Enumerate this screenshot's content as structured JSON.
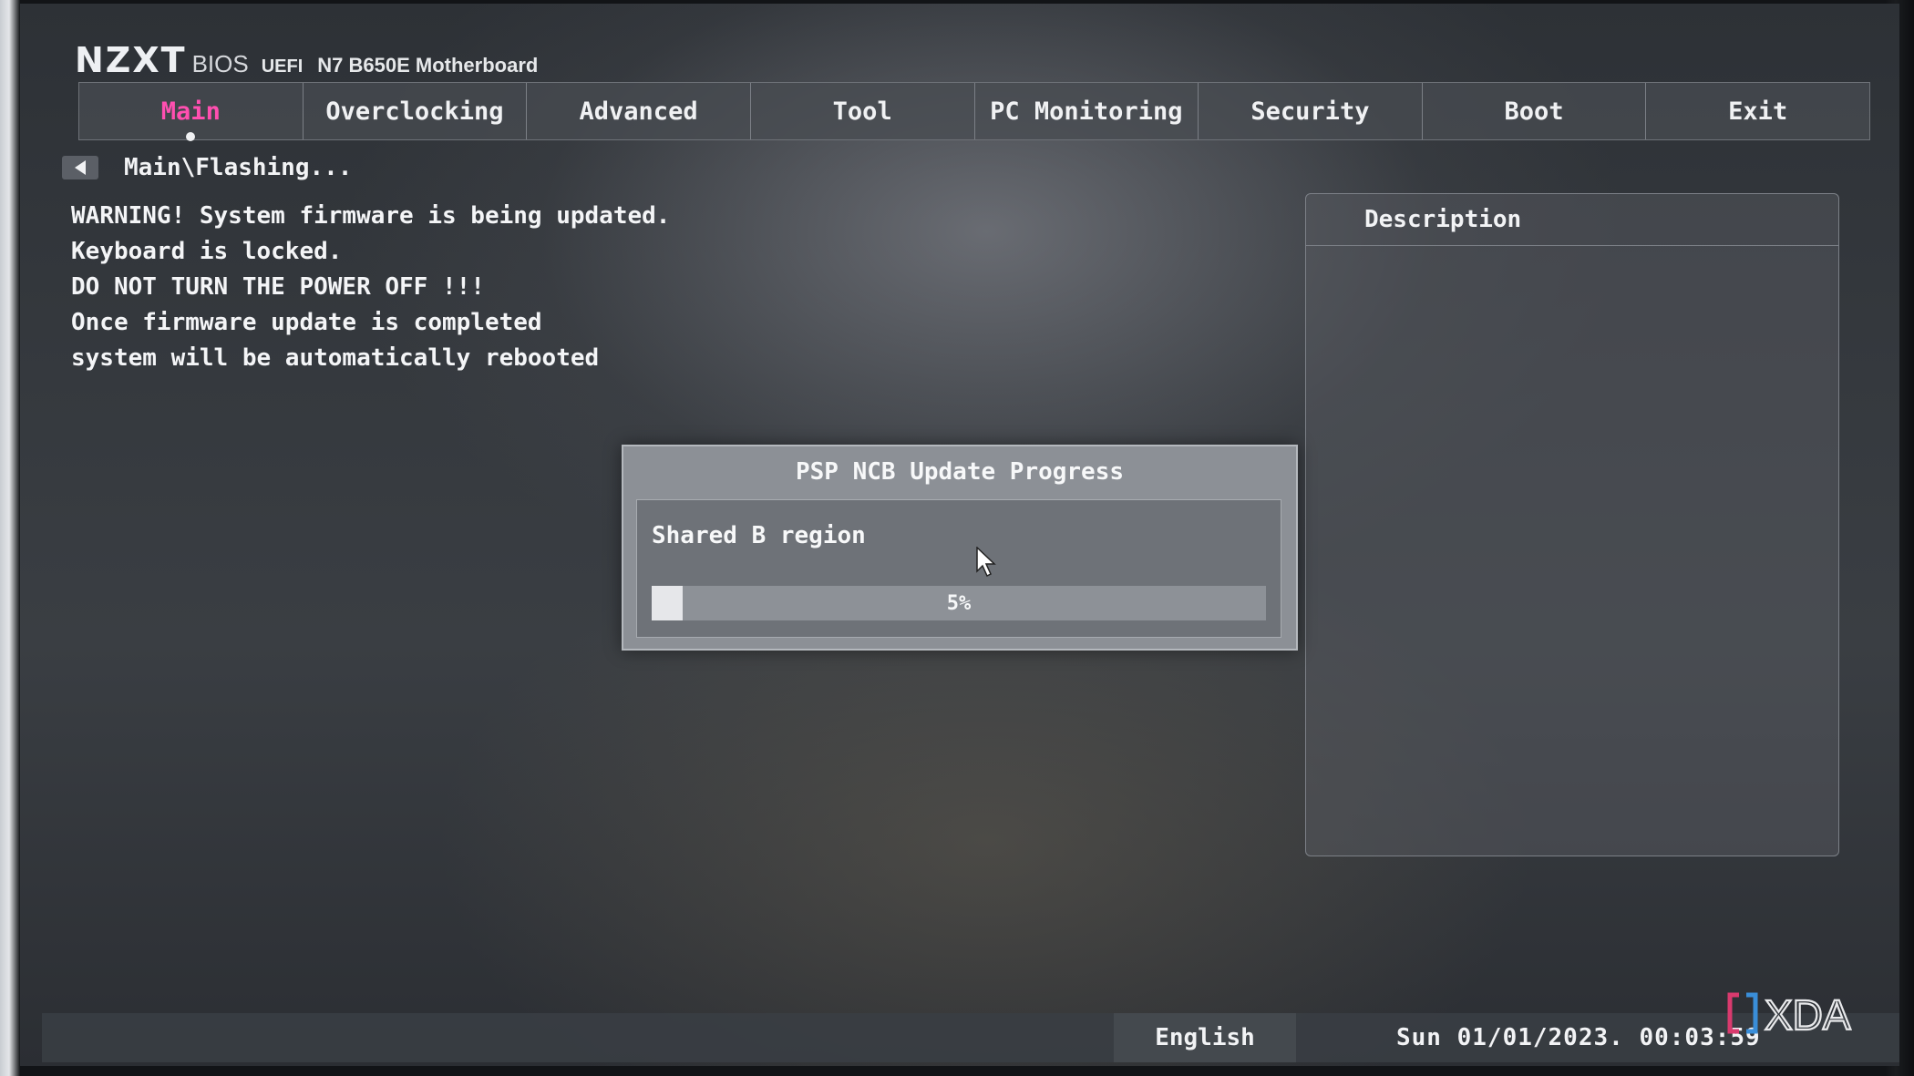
{
  "header": {
    "brand": "NZXT",
    "bios": "BIOS",
    "uefi": "UEFI",
    "model": "N7 B650E Motherboard"
  },
  "tabs": [
    {
      "label": "Main",
      "active": true
    },
    {
      "label": "Overclocking"
    },
    {
      "label": "Advanced"
    },
    {
      "label": "Tool"
    },
    {
      "label": "PC Monitoring"
    },
    {
      "label": "Security"
    },
    {
      "label": "Boot"
    },
    {
      "label": "Exit"
    }
  ],
  "breadcrumb": {
    "path": "Main\\Flashing..."
  },
  "warning": {
    "lines": [
      "WARNING! System firmware is being updated.",
      "Keyboard is locked.",
      "DO NOT TURN THE POWER OFF !!!",
      "Once firmware update is completed",
      "system will be automatically rebooted"
    ]
  },
  "description": {
    "title": "Description"
  },
  "dialog": {
    "title": "PSP NCB Update Progress",
    "region": "Shared B region",
    "progress_label": "5%",
    "progress": 0.05
  },
  "statusbar": {
    "language": "English",
    "datetime": "Sun 01/01/2023. 00:03:59"
  },
  "colors": {
    "active_tab": "#ff4fb0",
    "text": "#f2f3f5",
    "watermark_accent": "#d93a6e"
  },
  "icons": {
    "back": "back-arrow-icon",
    "cursor": "mouse-pointer-icon",
    "watermark": "xda-logo"
  },
  "watermark": {
    "text": "XDA"
  }
}
